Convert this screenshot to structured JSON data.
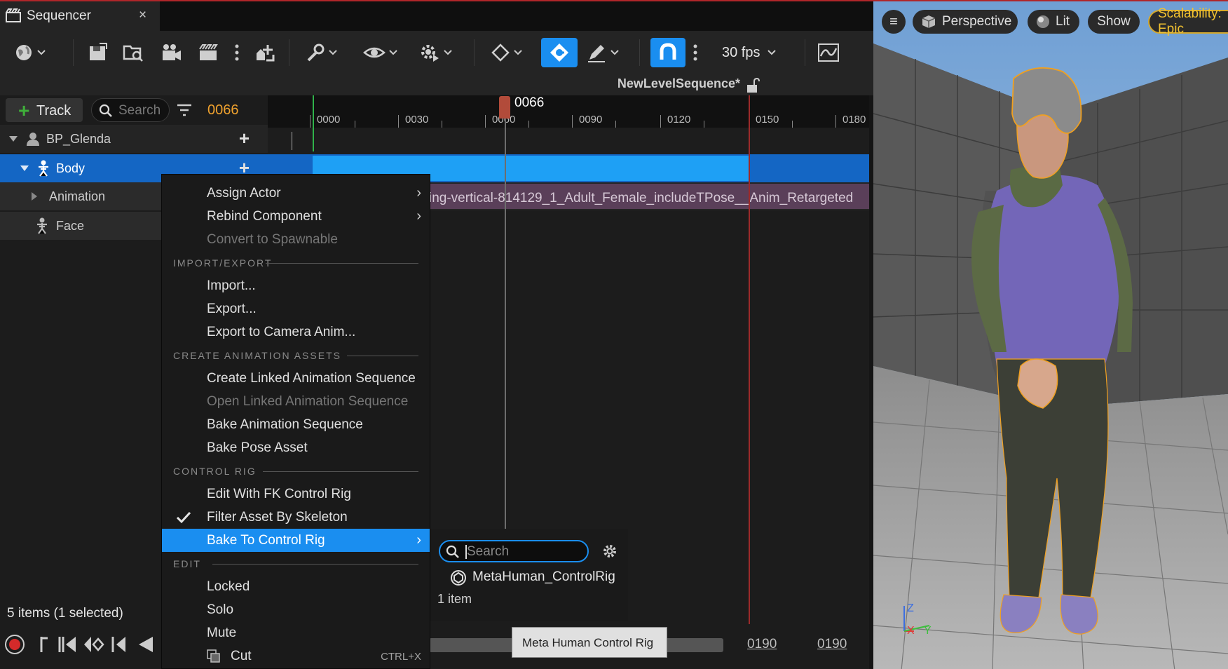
{
  "tab": {
    "title": "Sequencer",
    "close": "×"
  },
  "toolbar": {
    "fps": "30 fps"
  },
  "sequence": {
    "name": "NewLevelSequence*"
  },
  "outliner": {
    "add_track_label": "Track",
    "search_placeholder": "Search",
    "current_frame": "0066",
    "items": [
      {
        "label": "BP_Glenda"
      },
      {
        "label": "Body"
      },
      {
        "label": "Animation"
      },
      {
        "label": "Face"
      }
    ],
    "count_text": "5 items (1 selected)"
  },
  "timeline": {
    "ticks": [
      "0000",
      "0030",
      "0060",
      "0090",
      "0120",
      "0150",
      "0180"
    ],
    "playhead": "0066",
    "anim_clip_label": "ing-vertical-814129_1_Adult_Female_includeTPose__Anim_Retargeted",
    "range_start": "0190",
    "range_end": "0190"
  },
  "tooltip": {
    "text": "Meta Human Control Rig"
  },
  "context_menu": {
    "items": {
      "assign_actor": "Assign Actor",
      "rebind_component": "Rebind Component",
      "convert_spawnable": "Convert to Spawnable",
      "section_import_export": "IMPORT/EXPORT",
      "import": "Import...",
      "export": "Export...",
      "export_camera_anim": "Export to Camera Anim...",
      "section_create_anim": "CREATE ANIMATION ASSETS",
      "create_linked": "Create Linked Animation Sequence",
      "open_linked": "Open Linked Animation Sequence",
      "bake_anim_seq": "Bake Animation Sequence",
      "bake_pose": "Bake Pose Asset",
      "section_control_rig": "CONTROL RIG",
      "edit_fk": "Edit With FK Control Rig",
      "filter_asset": "Filter Asset By Skeleton",
      "bake_control_rig": "Bake To Control Rig",
      "section_edit": "EDIT",
      "locked": "Locked",
      "solo": "Solo",
      "mute": "Mute",
      "cut": "Cut",
      "cut_shortcut": "CTRL+X"
    }
  },
  "submenu": {
    "search_placeholder": "Search",
    "item": "MetaHuman_ControlRig",
    "count": "1 item"
  },
  "viewport": {
    "menu": "≡",
    "perspective": "Perspective",
    "lit": "Lit",
    "show": "Show",
    "scalability": "Scalability: Epic",
    "axis_z": "Z",
    "axis_x": "X",
    "axis_y": "Y"
  }
}
